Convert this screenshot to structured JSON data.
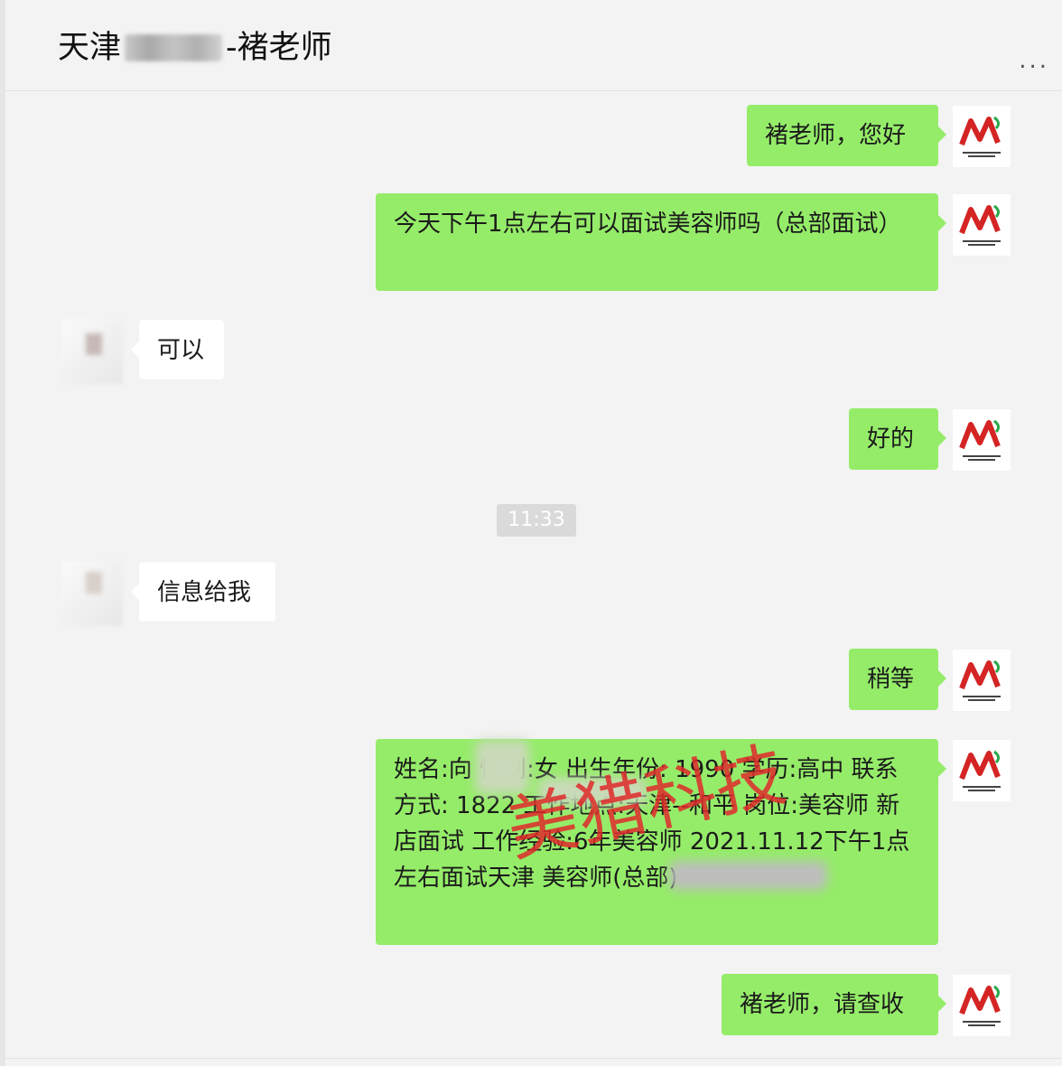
{
  "header": {
    "title_prefix": "天津",
    "title_suffix": "-褚老师",
    "more_label": "..."
  },
  "window_controls": [
    "⌖",
    "—",
    "▢",
    "✕"
  ],
  "messages": [
    {
      "side": "out",
      "text": "褚老师，您好"
    },
    {
      "side": "out",
      "text": "今天下午1点左右可以面试美容师吗（总部面试）"
    },
    {
      "side": "in",
      "text": "可以"
    },
    {
      "side": "out",
      "text": "好的"
    },
    {
      "side": "in",
      "text": "信息给我"
    },
    {
      "side": "out",
      "text": "稍等"
    },
    {
      "side": "out",
      "text": "姓名:向  性别:女 出生年份: 1990 学历:高中 联系方式: 1822  工作地点:天津--和平 岗位:美容师 新店面试 工作经验:6年美容师 2021.11.12下午1点左右面试天津        美容师(总部)"
    },
    {
      "side": "out",
      "text": "褚老师，请查收"
    }
  ],
  "timestamp": "11:33",
  "watermark": "美猎科技",
  "colors": {
    "outgoing_bubble": "#95ec69",
    "incoming_bubble": "#ffffff",
    "background": "#f3f3f3",
    "watermark": "#e02b2b"
  },
  "icons": {
    "more": "more-dots-icon",
    "self_avatar": "meilie-logo-icon"
  }
}
